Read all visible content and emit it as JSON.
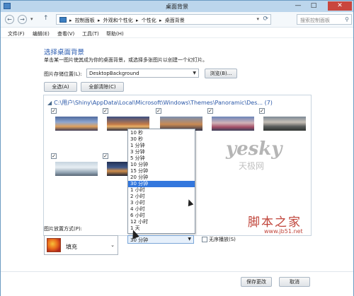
{
  "window": {
    "title": "桌面背景",
    "minimize": "—",
    "maximize": "□",
    "close": "✕"
  },
  "nav": {
    "back": "←",
    "forward": "→",
    "dropdown": "▾",
    "up": "↑",
    "breadcrumbs": [
      "控制面板",
      "外观和个性化",
      "个性化",
      "桌面背景"
    ],
    "separator": "▸",
    "search_placeholder": "搜索控制面板"
  },
  "menu": [
    "文件(F)",
    "编辑(E)",
    "查看(V)",
    "工具(T)",
    "帮助(H)"
  ],
  "main": {
    "heading": "选择桌面背景",
    "description": "单击某一图片使其成为你的桌面背景，或选择多张图片以创建一个幻灯片。",
    "location_label": "图片存储位置(L):",
    "location_value": "DesktopBackground",
    "browse": "浏览(B)...",
    "select_all": "全选(A)",
    "clear_all": "全部清除(C)",
    "folder_path": "C:\\用户\\Shiny\\AppData\\Local\\Microsoft\\Windows\\Themes\\Panoramic\\Des... (7)",
    "checkbox_mark": "✓",
    "position_label": "图片放置方式(P):",
    "position_value": "填充",
    "interval_value": "30 分钟",
    "shuffle_label": "无序播放(S)",
    "save": "保存更改",
    "cancel": "取消"
  },
  "interval_options": [
    "10 秒",
    "30 秒",
    "1 分钟",
    "3 分钟",
    "5 分钟",
    "10 分钟",
    "15 分钟",
    "20 分钟",
    "30 分钟",
    "1 小时",
    "2 小时",
    "3 小时",
    "4 小时",
    "6 小时",
    "12 小时",
    "1 天"
  ],
  "interval_selected_index": 8,
  "watermarks": {
    "yesky": "yesky",
    "yesky_cn": "天极网",
    "jb51": "脚本之家",
    "jb51_url": "www.jb51.net"
  },
  "icons": {
    "search": "search-icon",
    "refresh": "refresh-icon",
    "computer": "control-panel-icon"
  },
  "colors": {
    "accent": "#3377dd",
    "heading": "#2a5bb0",
    "titlebar": "#bcd6ec",
    "close": "#c9463d"
  }
}
